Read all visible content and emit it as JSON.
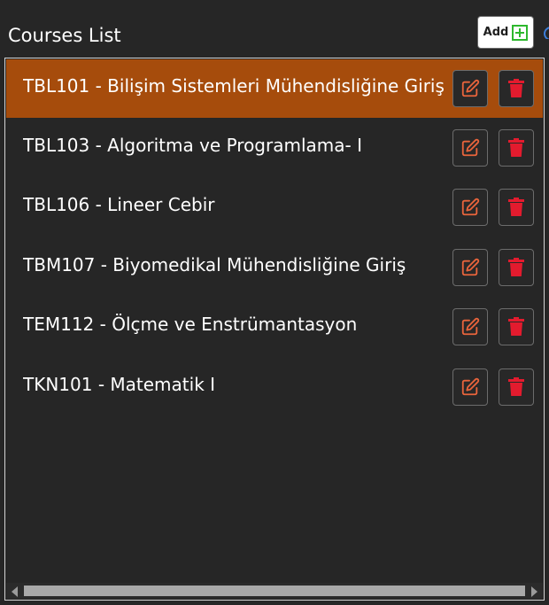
{
  "header": {
    "title": "Courses List",
    "add_label": "Add"
  },
  "colors": {
    "background": "#262626",
    "selected_row": "#a64c0c",
    "edit_icon": "#e8643c",
    "delete_icon": "#e31b2e",
    "add_plus": "#2eb82e"
  },
  "courses": [
    {
      "label": "TBL101 - Bilişim Sistemleri Mühendisliğine Giriş",
      "selected": true
    },
    {
      "label": "TBL103 - Algoritma ve Programlama- I",
      "selected": false
    },
    {
      "label": "TBL106 - Lineer Cebir",
      "selected": false
    },
    {
      "label": "TBM107 - Biyomedikal Mühendisliğine Giriş",
      "selected": false
    },
    {
      "label": "TEM112 - Ölçme ve Enstrümantasyon",
      "selected": false
    },
    {
      "label": "TKN101 - Matematik I",
      "selected": false
    }
  ],
  "icons": {
    "add": "plus-square-icon",
    "edit": "pencil-square-icon",
    "delete": "trash-icon"
  }
}
